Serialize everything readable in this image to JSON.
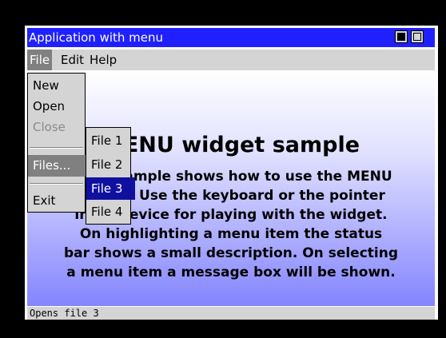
{
  "window": {
    "title": "Application with menu"
  },
  "menubar": {
    "items": [
      {
        "label": "File"
      },
      {
        "label": "Edit"
      },
      {
        "label": "Help"
      }
    ]
  },
  "file_menu": {
    "items": [
      {
        "label": "New",
        "state": "enabled"
      },
      {
        "label": "Open",
        "state": "enabled"
      },
      {
        "label": "Close",
        "state": "disabled"
      },
      {
        "label": "Files...",
        "state": "selected"
      },
      {
        "label": "Exit",
        "state": "enabled"
      }
    ]
  },
  "files_submenu": {
    "items": [
      {
        "label": "File 1"
      },
      {
        "label": "File 2"
      },
      {
        "label": "File 3",
        "state": "selected"
      },
      {
        "label": "File 4"
      }
    ]
  },
  "client": {
    "heading": "MENU widget sample",
    "description_lines": [
      "This example shows how to use the MENU",
      "widget. Use the keyboard or the pointer",
      "input device for playing with the widget.",
      "On highlighting a menu item the status",
      "bar shows a small description. On selecting",
      "a menu item a message box will be shown."
    ]
  },
  "statusbar": {
    "text": "Opens file 3"
  },
  "colors": {
    "titlebar": "#2020ff",
    "menu_face": "#d4d4d4",
    "selected_gray": "#808080",
    "selected_blue": "#1010a0",
    "gradient_bottom": "#8484ff"
  }
}
